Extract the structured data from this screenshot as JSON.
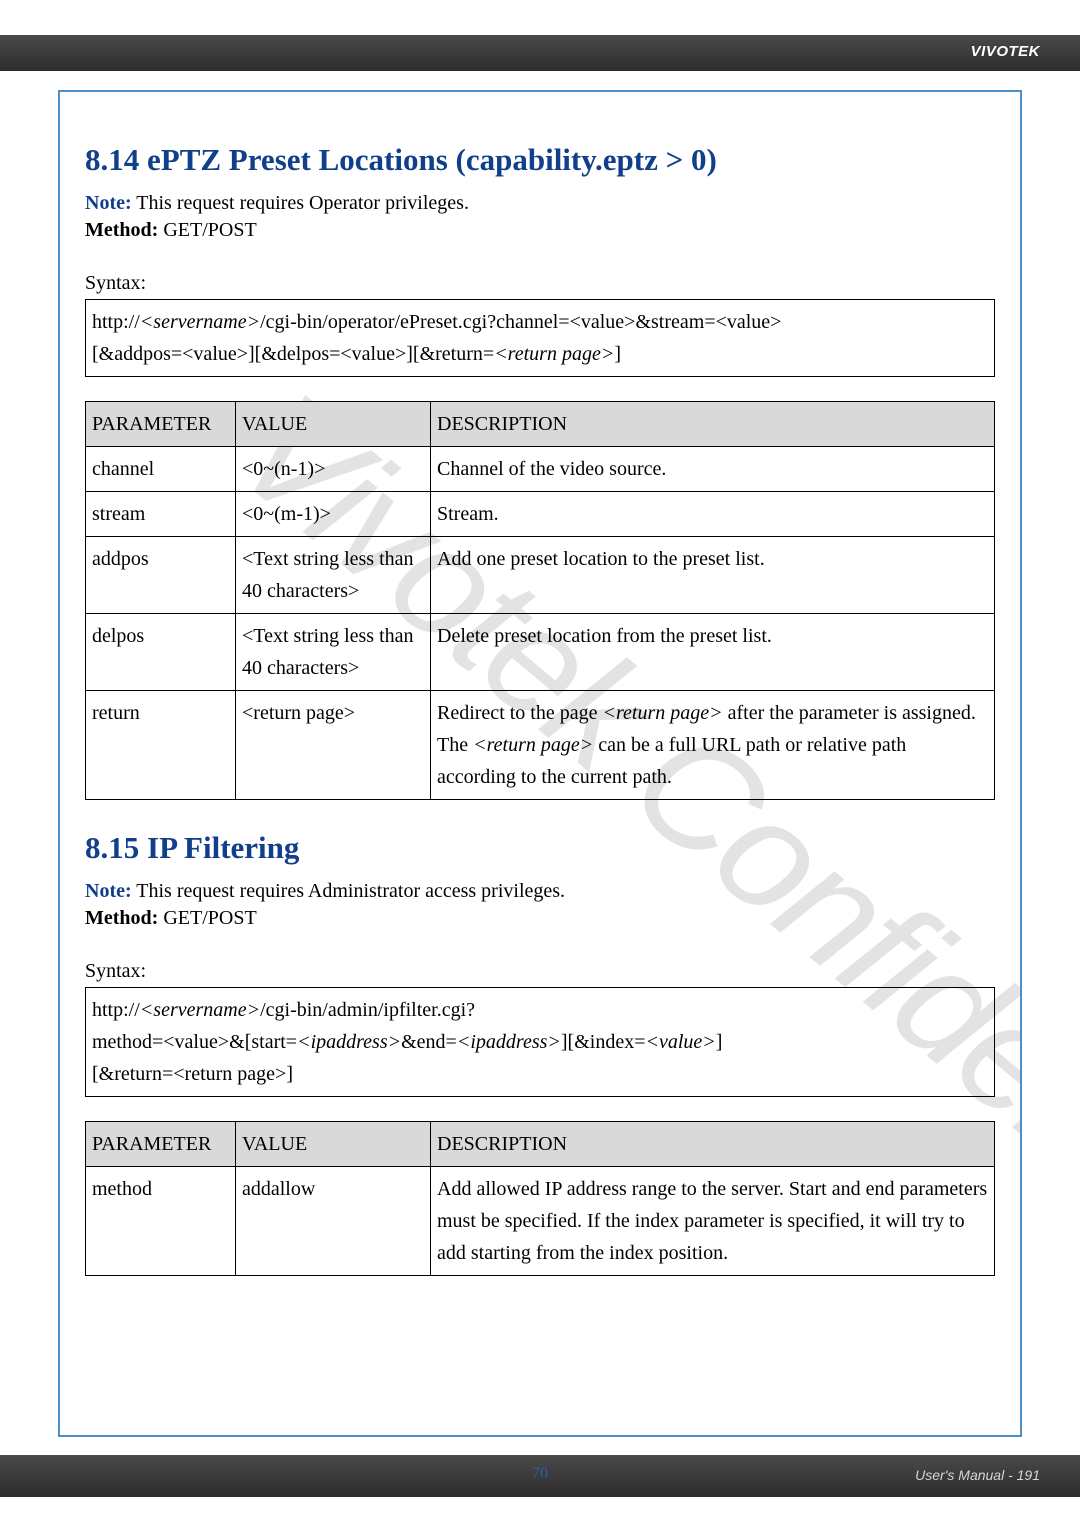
{
  "header": {
    "brand": "VIVOTEK"
  },
  "watermark": "Vivotek Confidential",
  "section1": {
    "heading": "8.14 ePTZ Preset Locations (capability.eptz > 0)",
    "note_label": "Note:",
    "note_text": " This request requires Operator privileges.",
    "method_label": "Method:",
    "method_text": " GET/POST",
    "syntax_label": "Syntax:",
    "syntax_line1_a": "http://",
    "syntax_line1_b": "<servername>",
    "syntax_line1_c": "/cgi-bin/operator/ePreset.cgi?channel=<value>&stream=<value>",
    "syntax_line2_a": "[&addpos=<value>][&delpos=<value>][&return=",
    "syntax_line2_b": "<return page>",
    "syntax_line2_c": "]",
    "table": {
      "headers": [
        "PARAMETER",
        "VALUE",
        "DESCRIPTION"
      ],
      "rows": [
        {
          "p": "channel",
          "v": "<0~(n-1)>",
          "d": "Channel of the video source."
        },
        {
          "p": "stream",
          "v": "<0~(m-1)>",
          "d": "Stream."
        },
        {
          "p": "addpos",
          "v": "<Text string less than 40 characters>",
          "d": "Add one preset location to the preset list."
        },
        {
          "p": "delpos",
          "v": "<Text string less than 40 characters>",
          "d": "Delete preset location from the preset list."
        },
        {
          "p": "return",
          "v": "<return page>",
          "d_a": "Redirect to the page ",
          "d_b": "<return page>",
          "d_c": " after the parameter is assigned. The ",
          "d_d": "<return page>",
          "d_e": " can be a full URL path or relative path according to the current path."
        }
      ]
    }
  },
  "section2": {
    "heading": "8.15 IP Filtering",
    "note_label": "Note:",
    "note_text": " This request requires Administrator access privileges.",
    "method_label": "Method:",
    "method_text": " GET/POST",
    "syntax_label": "Syntax:",
    "syntax_line1_a": "http://",
    "syntax_line1_b": "<servername>",
    "syntax_line1_c": "/cgi-bin/admin/ipfilter.cgi?",
    "syntax_line2_a": "method=<value>&[start=",
    "syntax_line2_b": "<ipaddress>",
    "syntax_line2_c": "&end=",
    "syntax_line2_d": "<ipaddress>",
    "syntax_line2_e": "][&index=",
    "syntax_line2_f": "<value>",
    "syntax_line2_g": "]",
    "syntax_line3": "[&return=<return page>]",
    "table": {
      "headers": [
        "PARAMETER",
        "VALUE",
        "DESCRIPTION"
      ],
      "rows": [
        {
          "p": "method",
          "v": "addallow",
          "d": "Add allowed IP address range to the server. Start and end parameters must be specified. If the index parameter is specified, it will try to add starting from the index position."
        }
      ]
    }
  },
  "footer": {
    "center_page": "70",
    "right_text": "User's Manual - 191"
  }
}
